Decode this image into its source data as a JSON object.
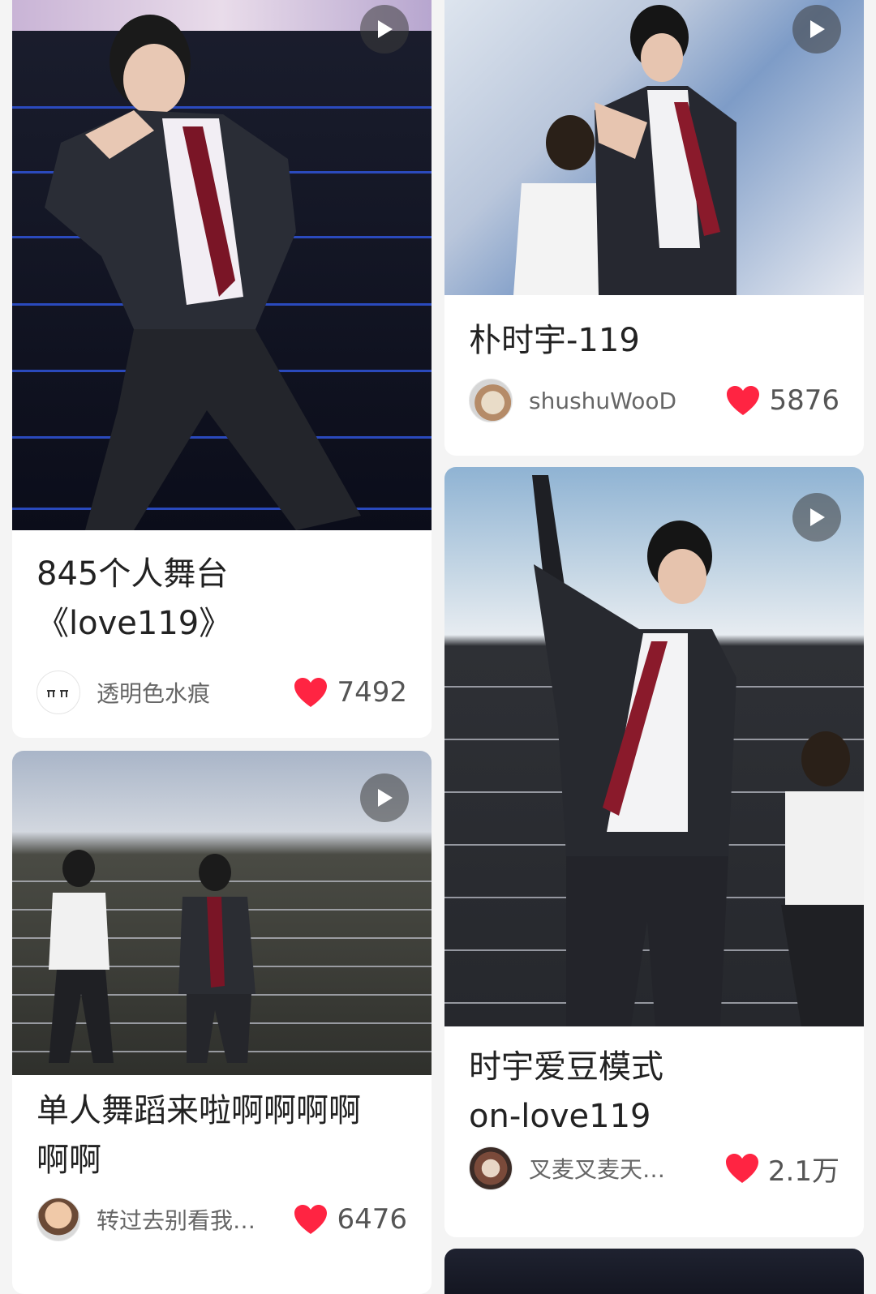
{
  "feed": {
    "cards": [
      {
        "title_line1": "845个人舞台",
        "title_line2": "《love119》",
        "author": "透明色水痕",
        "likes": "7492"
      },
      {
        "title_line1": "单人舞蹈来啦啊啊啊啊",
        "title_line2": "啊啊",
        "author": "转过去别看我…",
        "likes": "6476"
      },
      {
        "title_line1": "朴时宇-119",
        "author": "shushuWooD",
        "likes": "5876"
      },
      {
        "title_line1": "时宇爱豆模式",
        "title_line2": "on-love119",
        "author": "叉麦叉麦天…",
        "likes": "2.1万"
      }
    ]
  },
  "colors": {
    "heart": "#ff2442",
    "background": "#f4f4f4",
    "card": "#ffffff"
  },
  "icons": {
    "play": "play-icon",
    "like": "heart-icon"
  }
}
